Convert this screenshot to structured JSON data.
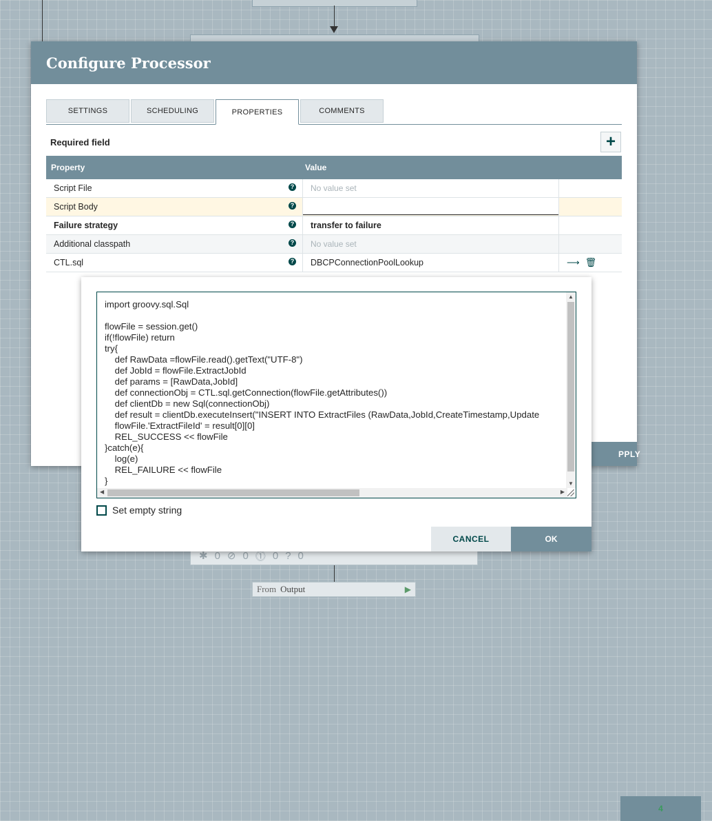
{
  "dialog": {
    "title": "Configure Processor",
    "tabs": [
      {
        "label": "SETTINGS"
      },
      {
        "label": "SCHEDULING"
      },
      {
        "label": "PROPERTIES"
      },
      {
        "label": "COMMENTS"
      }
    ],
    "active_tab": "PROPERTIES",
    "required_field_label": "Required field",
    "add_button_symbol": "+",
    "apply_label": "PPLY"
  },
  "properties_table": {
    "headers": {
      "property": "Property",
      "value": "Value"
    },
    "rows": [
      {
        "name": "Script File",
        "value": "No value set",
        "empty": true
      },
      {
        "name": "Script Body",
        "value": "",
        "editing": true
      },
      {
        "name": "Failure strategy",
        "value": "transfer to failure",
        "bold": true
      },
      {
        "name": "Additional classpath",
        "value": "No value set",
        "empty": true
      },
      {
        "name": "CTL.sql",
        "value": "DBCPConnectionPoolLookup"
      }
    ],
    "help_icon": "?"
  },
  "editor": {
    "code_lines": [
      "import groovy.sql.Sql",
      "",
      "flowFile = session.get()",
      "if(!flowFile) return",
      "try{",
      "    def RawData =flowFile.read().getText(\"UTF-8\")",
      "    def JobId = flowFile.ExtractJobId",
      "    def params = [RawData,JobId]",
      "    def connectionObj = CTL.sql.getConnection(flowFile.getAttributes())",
      "    def clientDb = new Sql(connectionObj)",
      "    def result = clientDb.executeInsert(\"INSERT INTO ExtractFiles (RawData,JobId,CreateTimestamp,Update",
      "    flowFile.'ExtractFileId' = result[0][0]",
      "    REL_SUCCESS << flowFile",
      "}catch(e){",
      "    log(e)",
      "    REL_FAILURE << flowFile",
      "}"
    ],
    "set_empty_string_label": "Set empty string",
    "cancel_label": "CANCEL",
    "ok_label": "OK"
  },
  "canvas": {
    "status_counts": [
      "4",
      "0",
      "0",
      "0",
      "0"
    ],
    "from_label": "From",
    "output_label": "Output"
  },
  "colors": {
    "header": "#728e9b",
    "accent": "#004849",
    "canvas": "#a9b8c0"
  }
}
